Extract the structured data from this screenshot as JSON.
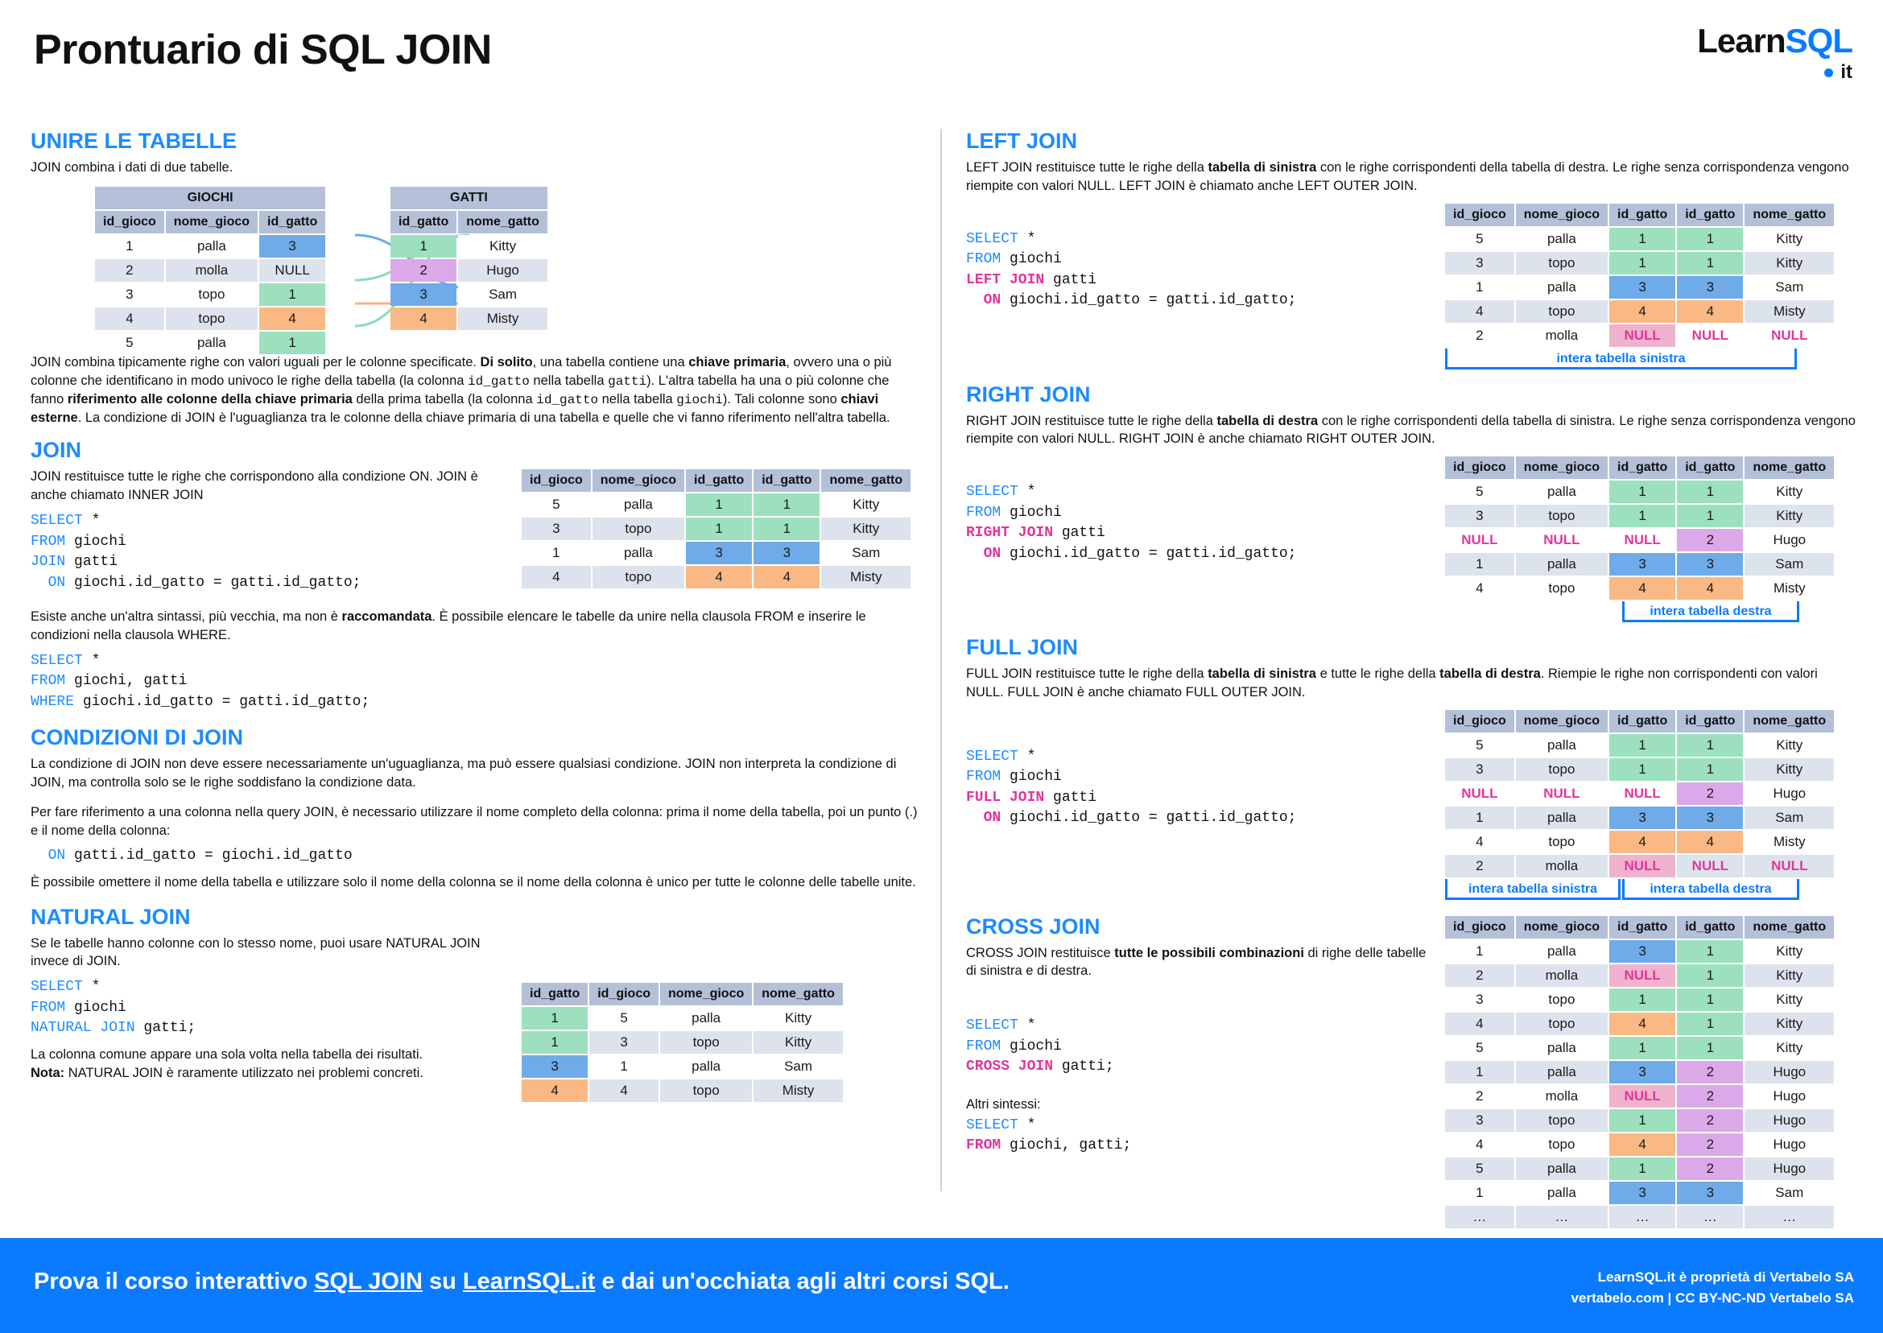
{
  "header": {
    "title": "Prontuario di SQL JOIN",
    "logo_dark": "Learn",
    "logo_blue": "SQL",
    "logo_tld": "it"
  },
  "colors": {
    "accent": "#0a7bff",
    "heading": "#1d8bff",
    "null_text": "#e0369b",
    "table_header": "#b3c0d8",
    "row_alt": "#dde3ec",
    "green": "#9ce0be",
    "blue": "#6fabe8",
    "orange": "#fab984",
    "purple": "#dba9e9",
    "pink": "#f0b3cd"
  },
  "unire": {
    "heading": "UNIRE LE TABELLE",
    "intro": "JOIN combina i dati di due tabelle.",
    "giochi": {
      "name": "GIOCHI",
      "columns": [
        "id_gioco",
        "nome_gioco",
        "id_gatto"
      ],
      "rows": [
        [
          "1",
          "palla",
          "3"
        ],
        [
          "2",
          "molla",
          "NULL"
        ],
        [
          "3",
          "topo",
          "1"
        ],
        [
          "4",
          "topo",
          "4"
        ],
        [
          "5",
          "palla",
          "1"
        ]
      ]
    },
    "gatti": {
      "name": "GATTI",
      "columns": [
        "id_gatto",
        "nome_gatto"
      ],
      "rows": [
        [
          "1",
          "Kitty"
        ],
        [
          "2",
          "Hugo"
        ],
        [
          "3",
          "Sam"
        ],
        [
          "4",
          "Misty"
        ]
      ]
    },
    "paragraph_1": "JOIN combina tipicamente righe con valori uguali per le colonne specificate. ",
    "paragraph_b1": "Di solito",
    "paragraph_2": ", una tabella contiene una ",
    "paragraph_b2": "chiave primaria",
    "paragraph_3": ", ovvero una o più colonne che identificano in modo univoco le righe della tabella (la colonna ",
    "paragraph_m1": "id_gatto",
    "paragraph_4": " nella tabella ",
    "paragraph_m2": "gatti",
    "paragraph_5": "). L'altra tabella ha una o più colonne che fanno ",
    "paragraph_b3": "riferimento alle colonne della chiave primaria",
    "paragraph_6": " della prima tabella (la colonna ",
    "paragraph_m3": "id_gatto",
    "paragraph_7": " nella tabella ",
    "paragraph_m4": "giochi",
    "paragraph_8": "). Tali colonne sono ",
    "paragraph_b4": "chiavi esterne",
    "paragraph_9": ". La condizione di JOIN è l'uguaglianza tra le colonne della chiave primaria di una tabella e quelle che vi fanno riferimento nell'altra tabella."
  },
  "join": {
    "heading": "JOIN",
    "desc": "JOIN restituisce tutte le righe che corrispondono alla condizione ON. JOIN è anche chiamato INNER JOIN",
    "code": [
      {
        "kw": "SELECT",
        "rest": " *"
      },
      {
        "kw": "FROM",
        "rest": " giochi"
      },
      {
        "kw": "JOIN",
        "rest": " gatti"
      },
      {
        "kw": "  ON",
        "rest": " giochi.id_gatto = gatti.id_gatto;"
      }
    ],
    "columns": [
      "id_gioco",
      "nome_gioco",
      "id_gatto",
      "id_gatto",
      "nome_gatto"
    ],
    "rows": [
      [
        "5",
        "palla",
        "1",
        "1",
        "Kitty"
      ],
      [
        "3",
        "topo",
        "1",
        "1",
        "Kitty"
      ],
      [
        "1",
        "palla",
        "3",
        "3",
        "Sam"
      ],
      [
        "4",
        "topo",
        "4",
        "4",
        "Misty"
      ]
    ]
  },
  "alt_syntax": {
    "text_1": "Esiste anche un'altra sintassi, più vecchia, ma non è ",
    "bold": "raccomandata",
    "text_2": ". È possibile elencare le tabelle da unire nella clausola FROM e inserire le condizioni nella clausola WHERE.",
    "code": [
      {
        "kw": "SELECT",
        "rest": " *"
      },
      {
        "kw": "FROM",
        "rest": " giochi, gatti"
      },
      {
        "kw": "WHERE",
        "rest": " giochi.id_gatto = gatti.id_gatto;"
      }
    ]
  },
  "condizioni": {
    "heading": "CONDIZIONI DI JOIN",
    "p1": "La condizione di JOIN non deve essere necessariamente un'uguaglianza, ma può essere qualsiasi condizione. JOIN non interpreta la condizione di JOIN, ma controlla solo se le righe soddisfano la condizione data.",
    "p2": "Per fare riferimento a una colonna nella query JOIN, è necessario utilizzare il nome completo della colonna: prima il nome della tabella, poi un punto (.) e il nome della colonna:",
    "code": [
      {
        "kw": "  ON",
        "rest": " gatti.id_gatto = giochi.id_gatto"
      }
    ],
    "p3": "È possibile omettere il nome della tabella e utilizzare solo il nome della colonna se il nome della colonna è unico per tutte le colonne delle tabelle unite."
  },
  "natural": {
    "heading": "NATURAL JOIN",
    "desc": "Se le tabelle hanno colonne con lo stesso nome, puoi usare NATURAL JOIN invece di JOIN.",
    "code": [
      {
        "kw": "SELECT",
        "rest": " *"
      },
      {
        "kw": "FROM",
        "rest": " giochi"
      },
      {
        "kw": "NATURAL JOIN",
        "rest": " gatti;"
      }
    ],
    "note_1": "La colonna comune appare una sola volta nella tabella dei risultati.",
    "note_label": "Nota:",
    "note_2": " NATURAL JOIN è raramente utilizzato nei problemi concreti.",
    "columns": [
      "id_gatto",
      "id_gioco",
      "nome_gioco",
      "nome_gatto"
    ],
    "rows": [
      [
        "1",
        "5",
        "palla",
        "Kitty"
      ],
      [
        "1",
        "3",
        "topo",
        "Kitty"
      ],
      [
        "3",
        "1",
        "palla",
        "Sam"
      ],
      [
        "4",
        "4",
        "topo",
        "Misty"
      ]
    ]
  },
  "left_join": {
    "heading": "LEFT JOIN",
    "desc_1": "LEFT JOIN restituisce tutte le righe della ",
    "desc_b": "tabella di sinistra",
    "desc_2": " con le righe corrispondenti della tabella di destra. Le righe senza corrispondenza vengono riempite con valori NULL. LEFT JOIN è chiamato anche LEFT OUTER JOIN.",
    "code": [
      {
        "kw": "SELECT",
        "rest": " *"
      },
      {
        "kw": "FROM",
        "rest": " giochi"
      },
      {
        "kwp": "LEFT JOIN",
        "rest": " gatti"
      },
      {
        "kwp": "  ON",
        "rest": " giochi.id_gatto = gatti.id_gatto;"
      }
    ],
    "columns": [
      "id_gioco",
      "nome_gioco",
      "id_gatto",
      "id_gatto",
      "nome_gatto"
    ],
    "rows": [
      [
        "5",
        "palla",
        "1",
        "1",
        "Kitty"
      ],
      [
        "3",
        "topo",
        "1",
        "1",
        "Kitty"
      ],
      [
        "1",
        "palla",
        "3",
        "3",
        "Sam"
      ],
      [
        "4",
        "topo",
        "4",
        "4",
        "Misty"
      ],
      [
        "2",
        "molla",
        "NULL",
        "NULL",
        "NULL"
      ]
    ],
    "bracket_label": "intera tabella sinistra"
  },
  "right_join": {
    "heading": "RIGHT JOIN",
    "desc_1": "RIGHT JOIN restituisce tutte le righe della ",
    "desc_b": "tabella di destra",
    "desc_2": " con le righe corrispondenti della tabella di sinistra. Le righe senza corrispondenza vengono riempite con valori NULL. RIGHT JOIN è anche chiamato RIGHT OUTER JOIN.",
    "code": [
      {
        "kw": "SELECT",
        "rest": " *"
      },
      {
        "kw": "FROM",
        "rest": " giochi"
      },
      {
        "kwp": "RIGHT JOIN",
        "rest": " gatti"
      },
      {
        "kwp": "  ON",
        "rest": " giochi.id_gatto = gatti.id_gatto;"
      }
    ],
    "columns": [
      "id_gioco",
      "nome_gioco",
      "id_gatto",
      "id_gatto",
      "nome_gatto"
    ],
    "rows": [
      [
        "5",
        "palla",
        "1",
        "1",
        "Kitty"
      ],
      [
        "3",
        "topo",
        "1",
        "1",
        "Kitty"
      ],
      [
        "NULL",
        "NULL",
        "NULL",
        "2",
        "Hugo"
      ],
      [
        "1",
        "palla",
        "3",
        "3",
        "Sam"
      ],
      [
        "4",
        "topo",
        "4",
        "4",
        "Misty"
      ]
    ],
    "bracket_label": "intera tabella destra"
  },
  "full_join": {
    "heading": "FULL JOIN",
    "desc_1": "FULL JOIN restituisce tutte le righe della ",
    "desc_b1": "tabella di sinistra",
    "desc_2": " e tutte le righe della ",
    "desc_b2": "tabella di destra",
    "desc_3": ". Riempie le righe non corrispondenti con valori NULL. FULL JOIN è anche chiamato FULL OUTER JOIN.",
    "code": [
      {
        "kw": "SELECT",
        "rest": " *"
      },
      {
        "kw": "FROM",
        "rest": " giochi"
      },
      {
        "kwp": "FULL JOIN",
        "rest": " gatti"
      },
      {
        "kwp": "  ON",
        "rest": " giochi.id_gatto = gatti.id_gatto;"
      }
    ],
    "columns": [
      "id_gioco",
      "nome_gioco",
      "id_gatto",
      "id_gatto",
      "nome_gatto"
    ],
    "rows": [
      [
        "5",
        "palla",
        "1",
        "1",
        "Kitty"
      ],
      [
        "3",
        "topo",
        "1",
        "1",
        "Kitty"
      ],
      [
        "NULL",
        "NULL",
        "NULL",
        "2",
        "Hugo"
      ],
      [
        "1",
        "palla",
        "3",
        "3",
        "Sam"
      ],
      [
        "4",
        "topo",
        "4",
        "4",
        "Misty"
      ],
      [
        "2",
        "molla",
        "NULL",
        "NULL",
        "NULL"
      ]
    ],
    "bracket_left": "intera tabella sinistra",
    "bracket_right": "intera tabella destra"
  },
  "cross_join": {
    "heading": "CROSS JOIN",
    "desc_1": "CROSS JOIN restituisce ",
    "desc_b": "tutte le possibili combinazioni",
    "desc_2": " di righe delle tabelle di sinistra e di destra.",
    "code": [
      {
        "kw": "SELECT",
        "rest": " *"
      },
      {
        "kw": "FROM",
        "rest": " giochi"
      },
      {
        "kwp": "CROSS JOIN",
        "rest": " gatti;"
      }
    ],
    "alt_label": "Altri sintessi:",
    "code2": [
      {
        "kw": "SELECT",
        "rest": " *"
      },
      {
        "kwp": "FROM",
        "rest": " giochi, gatti;"
      }
    ],
    "columns": [
      "id_gioco",
      "nome_gioco",
      "id_gatto",
      "id_gatto",
      "nome_gatto"
    ],
    "rows": [
      [
        "1",
        "palla",
        "3",
        "1",
        "Kitty"
      ],
      [
        "2",
        "molla",
        "NULL",
        "1",
        "Kitty"
      ],
      [
        "3",
        "topo",
        "1",
        "1",
        "Kitty"
      ],
      [
        "4",
        "topo",
        "4",
        "1",
        "Kitty"
      ],
      [
        "5",
        "palla",
        "1",
        "1",
        "Kitty"
      ],
      [
        "1",
        "palla",
        "3",
        "2",
        "Hugo"
      ],
      [
        "2",
        "molla",
        "NULL",
        "2",
        "Hugo"
      ],
      [
        "3",
        "topo",
        "1",
        "2",
        "Hugo"
      ],
      [
        "4",
        "topo",
        "4",
        "2",
        "Hugo"
      ],
      [
        "5",
        "palla",
        "1",
        "2",
        "Hugo"
      ],
      [
        "1",
        "palla",
        "3",
        "3",
        "Sam"
      ],
      [
        "…",
        "…",
        "…",
        "…",
        "…"
      ]
    ]
  },
  "footer": {
    "text_1": "Prova il corso interattivo ",
    "link_1": "SQL JOIN",
    "text_2": " su ",
    "link_2": "LearnSQL.it",
    "text_3": " e dai un'occhiata agli altri corsi SQL.",
    "right_1": "LearnSQL.it è proprietà di Vertabelo SA",
    "right_2": "vertabelo.com | CC BY-NC-ND Vertabelo SA"
  }
}
